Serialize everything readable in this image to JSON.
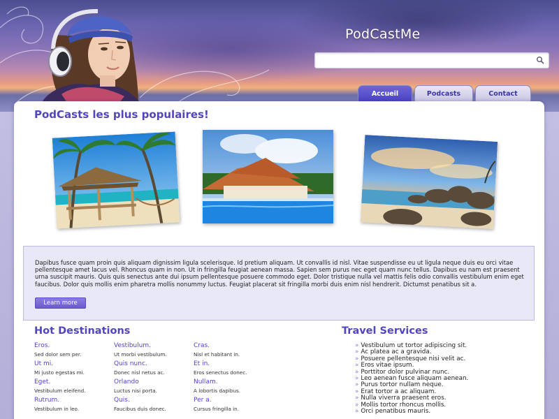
{
  "site": {
    "title": "PodCastMe",
    "search_placeholder": ""
  },
  "tabs": [
    {
      "label": "Accueil",
      "active": true
    },
    {
      "label": "Podcasts",
      "active": false
    },
    {
      "label": "Contact",
      "active": false
    }
  ],
  "popular": {
    "title": "PodCasts les plus populaires!",
    "photos": [
      {
        "icon": "beach-gazebo-photo"
      },
      {
        "icon": "resort-pool-photo"
      },
      {
        "icon": "sunset-rocks-photo"
      }
    ]
  },
  "intro": {
    "text": "Dapibus fusce quam proin quis aliquam dignissim ligula scelerisque. Id pretium aliquam. Ut convallis id nisl. Vitae suspendisse eu ut ligula neque duis eu orci vitae pellentesque amet lacus vel. Rhoncus quam in non. Ut in fringilla feugiat aenean massa. Sapien sem purus nec eget quam nunc tellus. Dapibus eu nam est praesent urna suscipit mauris. Quis quis senectus ante dui ipsum pellentesque posuere commodo eget. Dolor tristique nulla vel mattis felis odio convallis vestibulum enim eget faucibus. Dolor quis mollis enim pharetra mollis nonummy luctus. Feugiat placerat sit fringilla morbi duis enim nisl hendrerit. Dictumst penatibus sit a.",
    "button": "Learn more"
  },
  "destinations": {
    "title": "Hot Destinations",
    "items": [
      {
        "name": "Eros.",
        "desc": "Sed dolor sem per."
      },
      {
        "name": "Vestibulum.",
        "desc": "Ut morbi vestibulum."
      },
      {
        "name": "Cras.",
        "desc": "Nisl et habitant in."
      },
      {
        "name": "Ut mi.",
        "desc": "Mi justo egestas mi."
      },
      {
        "name": "Quis nunc.",
        "desc": "Donec nisl netus ac."
      },
      {
        "name": "Et in.",
        "desc": "Eros senectus donec."
      },
      {
        "name": "Eget.",
        "desc": "Vestibulum eleifend."
      },
      {
        "name": "Orlando",
        "desc": "Luctus nisi porta."
      },
      {
        "name": "Nullam.",
        "desc": "A lobortis dapibus."
      },
      {
        "name": "Rutrum.",
        "desc": "Vestibulum in leo."
      },
      {
        "name": "Quis.",
        "desc": "Faucibus duis donec."
      },
      {
        "name": "Per a.",
        "desc": "Cursus fringilla in."
      }
    ]
  },
  "services": {
    "title": "Travel Services",
    "items": [
      "Vestibulum ut tortor adipiscing sit.",
      "Ac platea ac a gravida.",
      "Posuere pellentesque nisi velit ac.",
      "Eros vitae ipsum.",
      "Porttitor dolor pulvinar nunc.",
      "Leo aenean fusce aliquam aenean.",
      "Purus tortor nullam neque.",
      "Erat tortor a ac aliquam.",
      "Nulla viverra praesent eros.",
      "Mollis tortor rhoncus mollis.",
      "Orci penatibus mauris."
    ],
    "bullet": "»"
  }
}
